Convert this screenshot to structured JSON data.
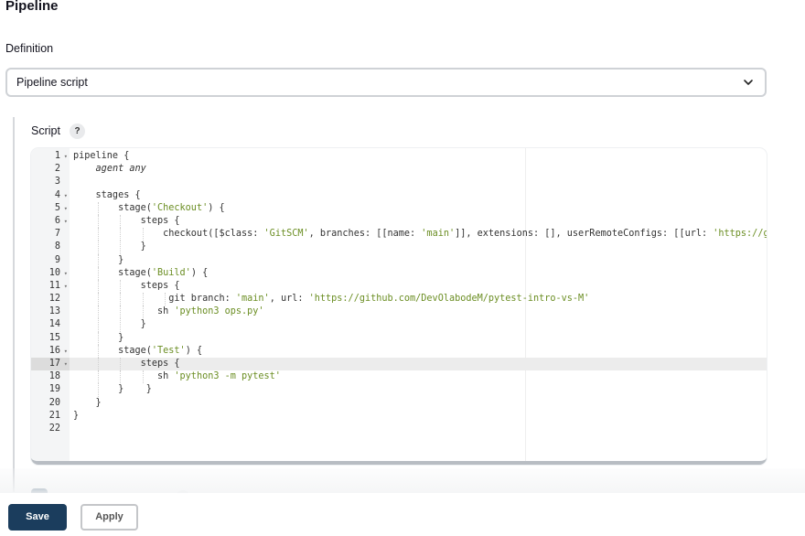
{
  "section": {
    "title": "Pipeline"
  },
  "definition": {
    "label": "Definition",
    "selected": "Pipeline script",
    "dropdown_icon": "chevron-down-icon"
  },
  "script": {
    "label": "Script",
    "help_label": "?",
    "active_line": 17,
    "lines": [
      {
        "n": "1",
        "fold": true,
        "text": "pipeline {"
      },
      {
        "n": "2",
        "fold": false,
        "text": "    agent any"
      },
      {
        "n": "3",
        "fold": false,
        "text": ""
      },
      {
        "n": "4",
        "fold": true,
        "text": "    stages {"
      },
      {
        "n": "5",
        "fold": true,
        "text": "        stage('Checkout') {"
      },
      {
        "n": "6",
        "fold": true,
        "text": "            steps {"
      },
      {
        "n": "7",
        "fold": false,
        "text": "                checkout([$class: 'GitSCM', branches: [[name: 'main']], extensions: [], userRemoteConfigs: [[url: 'https://g"
      },
      {
        "n": "8",
        "fold": false,
        "text": "            }"
      },
      {
        "n": "9",
        "fold": false,
        "text": "        }"
      },
      {
        "n": "10",
        "fold": true,
        "text": "        stage('Build') {"
      },
      {
        "n": "11",
        "fold": true,
        "text": "            steps {"
      },
      {
        "n": "12",
        "fold": false,
        "text": "                 git branch: 'main', url: 'https://github.com/DevOlabodeM/pytest-intro-vs-M'"
      },
      {
        "n": "13",
        "fold": false,
        "text": "               sh 'python3 ops.py'"
      },
      {
        "n": "14",
        "fold": false,
        "text": "            }"
      },
      {
        "n": "15",
        "fold": false,
        "text": "        }"
      },
      {
        "n": "16",
        "fold": true,
        "text": "        stage('Test') {"
      },
      {
        "n": "17",
        "fold": true,
        "text": "            steps {"
      },
      {
        "n": "18",
        "fold": false,
        "text": "               sh 'python3 -m pytest'"
      },
      {
        "n": "19",
        "fold": false,
        "text": "        }    }"
      },
      {
        "n": "20",
        "fold": false,
        "text": "    }"
      },
      {
        "n": "21",
        "fold": false,
        "text": "}"
      },
      {
        "n": "22",
        "fold": false,
        "text": ""
      }
    ]
  },
  "buttons": {
    "save": "Save",
    "apply": "Apply"
  }
}
